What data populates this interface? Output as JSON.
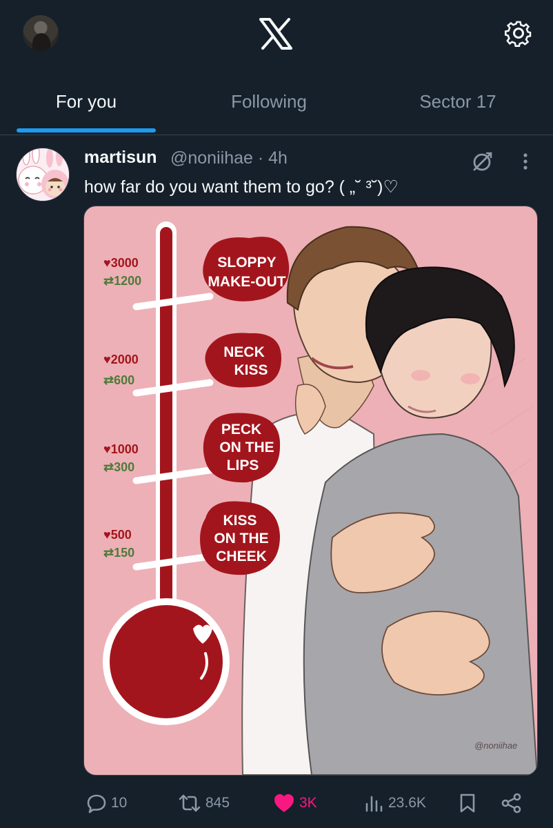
{
  "header": {
    "logo_icon": "x-logo-icon",
    "settings_icon": "gear-icon"
  },
  "tabs": [
    {
      "label": "For you",
      "active": true
    },
    {
      "label": "Following",
      "active": false
    },
    {
      "label": "Sector 17",
      "active": false
    }
  ],
  "post": {
    "display_name": "martisun",
    "handle": "@noniihae",
    "time": "· 4h",
    "text": "how far do you want them to go? ( „˘ ³˘)♡",
    "image": {
      "levels": [
        {
          "hearts": "3000",
          "reposts": "1200",
          "label_lines": [
            "SLOPPY",
            "MAKE-OUT"
          ]
        },
        {
          "hearts": "2000",
          "reposts": "600",
          "label_lines": [
            "NECK",
            "KISS"
          ]
        },
        {
          "hearts": "1000",
          "reposts": "300",
          "label_lines": [
            "PECK",
            "ON THE",
            "LIPS"
          ]
        },
        {
          "hearts": "500",
          "reposts": "150",
          "label_lines": [
            "KISS",
            "ON THE",
            "CHEEK"
          ]
        }
      ],
      "signature": "@noniihae"
    },
    "actions": {
      "replies": "10",
      "reposts": "845",
      "likes": "3K",
      "views": "23.6K"
    }
  },
  "colors": {
    "background": "#15202b",
    "accent": "#1d9bf0",
    "like": "#f91880",
    "muted": "#8b98a5",
    "art_background": "#edb0b6",
    "thermometer_red": "#a3151d"
  }
}
